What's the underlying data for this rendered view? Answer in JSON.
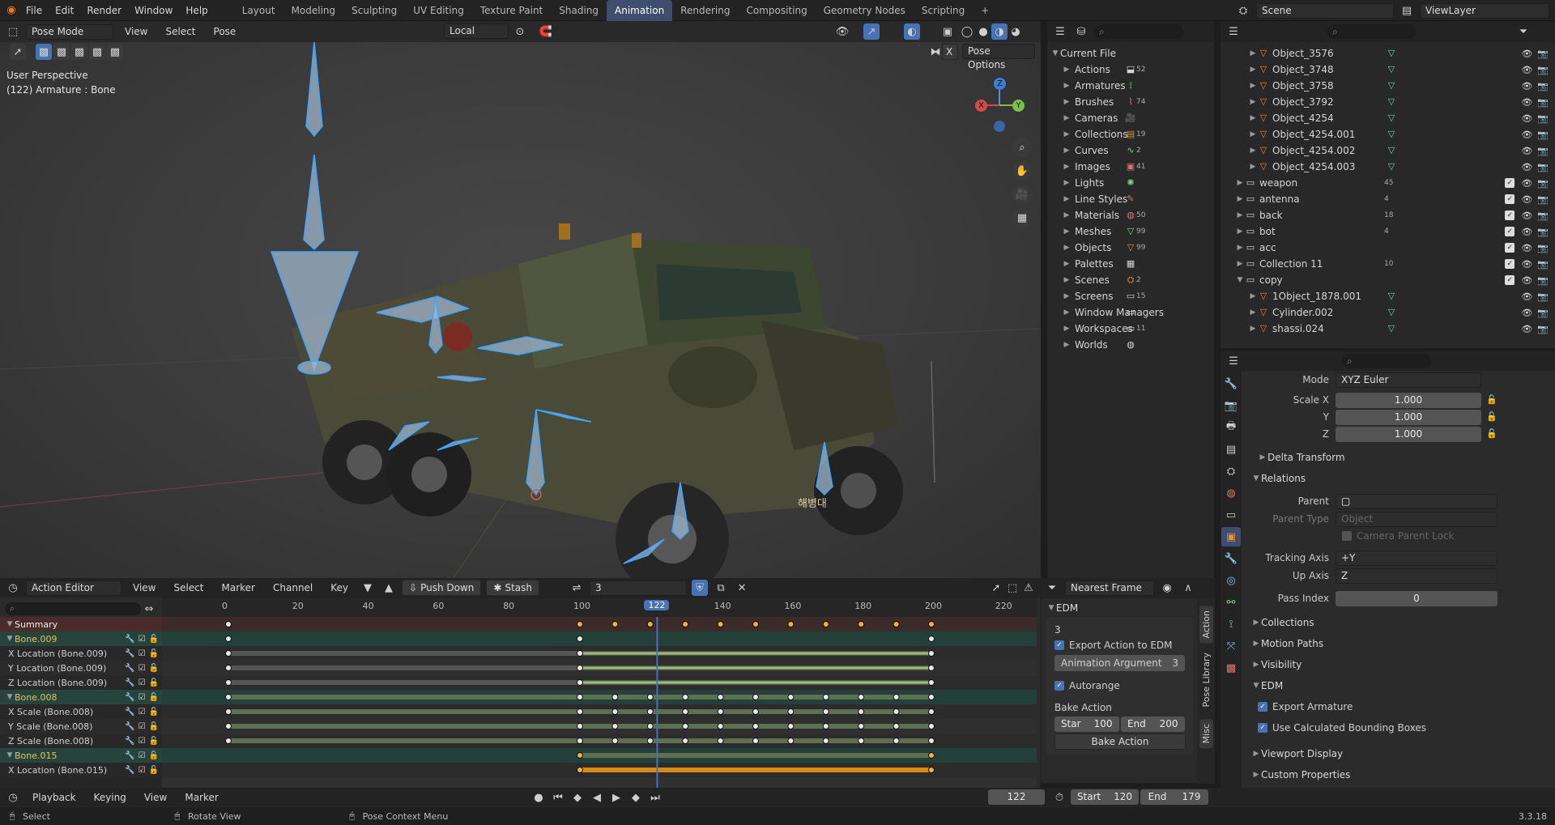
{
  "topbar": {
    "menus": [
      "File",
      "Edit",
      "Render",
      "Window",
      "Help"
    ],
    "workspaces": [
      "Layout",
      "Modeling",
      "Sculpting",
      "UV Editing",
      "Texture Paint",
      "Shading",
      "Animation",
      "Rendering",
      "Compositing",
      "Geometry Nodes",
      "Scripting"
    ],
    "active_workspace": "Animation",
    "add_tab": "+",
    "scene": "Scene",
    "view_layer": "ViewLayer"
  },
  "viewport": {
    "mode": "Pose Mode",
    "menus": [
      "View",
      "Select",
      "Pose"
    ],
    "transform_orientation": "Local",
    "pose_options": "Pose Options",
    "x_label": "X",
    "overlay_line1": "User Perspective",
    "overlay_line2": "(122) Armature : Bone",
    "gizmo": {
      "z": "Z",
      "y": "Y",
      "x": "X"
    },
    "plate_text": "해병대"
  },
  "blend_outliner": {
    "root": "Current File",
    "items": [
      {
        "label": "Actions",
        "count": "52"
      },
      {
        "label": "Armatures",
        "count": ""
      },
      {
        "label": "Brushes",
        "count": "74"
      },
      {
        "label": "Cameras",
        "count": ""
      },
      {
        "label": "Collections",
        "count": "19"
      },
      {
        "label": "Curves",
        "count": "2"
      },
      {
        "label": "Images",
        "count": "41"
      },
      {
        "label": "Lights",
        "count": ""
      },
      {
        "label": "Line Styles",
        "count": ""
      },
      {
        "label": "Materials",
        "count": "50"
      },
      {
        "label": "Meshes",
        "count": "99"
      },
      {
        "label": "Objects",
        "count": "99"
      },
      {
        "label": "Palettes",
        "count": ""
      },
      {
        "label": "Scenes",
        "count": "2"
      },
      {
        "label": "Screens",
        "count": "15"
      },
      {
        "label": "Window Managers",
        "count": ""
      },
      {
        "label": "Workspaces",
        "count": "11"
      },
      {
        "label": "Worlds",
        "count": ""
      }
    ]
  },
  "scene_outliner": {
    "items": [
      {
        "label": "Object_3576",
        "type": "obj",
        "count": ""
      },
      {
        "label": "Object_3748",
        "type": "obj",
        "count": ""
      },
      {
        "label": "Object_3758",
        "type": "obj",
        "count": ""
      },
      {
        "label": "Object_3792",
        "type": "obj",
        "count": ""
      },
      {
        "label": "Object_4254",
        "type": "obj",
        "count": ""
      },
      {
        "label": "Object_4254.001",
        "type": "obj",
        "count": ""
      },
      {
        "label": "Object_4254.002",
        "type": "obj",
        "count": ""
      },
      {
        "label": "Object_4254.003",
        "type": "obj",
        "count": ""
      },
      {
        "label": "weapon",
        "type": "col",
        "count": "45"
      },
      {
        "label": "antenna",
        "type": "col",
        "count": "4"
      },
      {
        "label": "back",
        "type": "col",
        "count": "18"
      },
      {
        "label": "bot",
        "type": "col",
        "count": "4"
      },
      {
        "label": "acc",
        "type": "col",
        "count": ""
      },
      {
        "label": "Collection 11",
        "type": "col",
        "count": "10"
      },
      {
        "label": "copy",
        "type": "col",
        "count": ""
      },
      {
        "label": "1Object_1878.001",
        "type": "obj",
        "count": ""
      },
      {
        "label": "Cylinder.002",
        "type": "obj",
        "count": ""
      },
      {
        "label": "shassi.024",
        "type": "obj",
        "count": ""
      }
    ]
  },
  "properties": {
    "mode_label": "Mode",
    "mode_value": "XYZ Euler",
    "scale_x_label": "Scale X",
    "scale_x": "1.000",
    "scale_y_label": "Y",
    "scale_y": "1.000",
    "scale_z_label": "Z",
    "scale_z": "1.000",
    "delta_transform": "Delta Transform",
    "relations": "Relations",
    "parent_label": "Parent",
    "parent_type_label": "Parent Type",
    "parent_type_value": "Object",
    "camera_parent_lock": "Camera Parent Lock",
    "tracking_axis_label": "Tracking Axis",
    "tracking_axis_value": "+Y",
    "up_axis_label": "Up Axis",
    "up_axis_value": "Z",
    "pass_index_label": "Pass Index",
    "pass_index_value": "0",
    "collections": "Collections",
    "motion_paths": "Motion Paths",
    "visibility": "Visibility",
    "edm": "EDM",
    "export_armature": "Export Armature",
    "use_bounding": "Use Calculated Bounding Boxes",
    "viewport_display": "Viewport Display",
    "custom_properties": "Custom Properties"
  },
  "timeline": {
    "editor": "Action Editor",
    "menus": [
      "View",
      "Select",
      "Marker",
      "Channel",
      "Key"
    ],
    "push_down": "Push Down",
    "stash": "Stash",
    "action_name": "3",
    "snap": "Nearest Frame",
    "ruler": [
      "0",
      "20",
      "40",
      "60",
      "80",
      "100",
      "120",
      "140",
      "160",
      "180",
      "200",
      "220"
    ],
    "current_frame": "122",
    "channels": [
      {
        "label": "Summary",
        "kind": "summary"
      },
      {
        "label": "Bone.009",
        "kind": "group"
      },
      {
        "label": "X Location (Bone.009)",
        "kind": "curve"
      },
      {
        "label": "Y Location (Bone.009)",
        "kind": "curve"
      },
      {
        "label": "Z Location (Bone.009)",
        "kind": "curve"
      },
      {
        "label": "Bone.008",
        "kind": "group"
      },
      {
        "label": "X Scale (Bone.008)",
        "kind": "curve"
      },
      {
        "label": "Y Scale (Bone.008)",
        "kind": "curve"
      },
      {
        "label": "Z Scale (Bone.008)",
        "kind": "curve"
      },
      {
        "label": "Bone.015",
        "kind": "group"
      },
      {
        "label": "X Location (Bone.015)",
        "kind": "curve"
      }
    ]
  },
  "edm_panel": {
    "title": "EDM",
    "action_value": "3",
    "export_action": "Export Action to EDM",
    "anim_arg_label": "Animation Argument",
    "anim_arg_value": "3",
    "autorange": "Autorange",
    "bake_action_label": "Bake Action",
    "start_label": "Star",
    "start_value": "100",
    "end_label": "End",
    "end_value": "200",
    "bake_button": "Bake Action",
    "tabs": [
      "Action",
      "Pose Library",
      "Misc"
    ]
  },
  "playback": {
    "menus": [
      "Playback",
      "Keying",
      "View",
      "Marker"
    ],
    "frame": "122",
    "start_label": "Start",
    "start": "120",
    "end_label": "End",
    "end": "179"
  },
  "statusbar": {
    "select": "Select",
    "rotate": "Rotate View",
    "context": "Pose Context Menu",
    "version": "3.3.18"
  }
}
